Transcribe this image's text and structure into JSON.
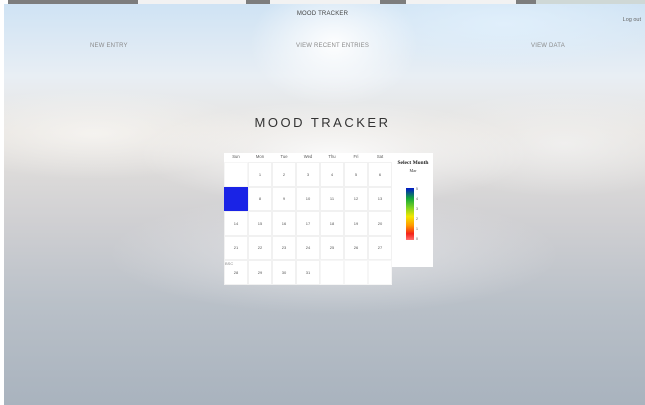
{
  "brand": "MOOD TRACKER",
  "logout": "Log out",
  "nav": {
    "new_entry": "NEW ENTRY",
    "recent": "VIEW RECENT ENTRIES",
    "data": "VIEW DATA"
  },
  "title": "MOOD TRACKER",
  "calendar": {
    "days_of_week": [
      "Sun",
      "Mon",
      "Tue",
      "Wed",
      "Thu",
      "Fri",
      "Sat"
    ],
    "leading_blanks": 1,
    "days_in_month": 31,
    "selected_day": 7,
    "selected_color": "#1a23e6",
    "footnote": "BSC"
  },
  "selector": {
    "title": "Select Month",
    "month": "Mar",
    "legend_labels": [
      "5",
      "4",
      "3",
      "2",
      "1",
      "0"
    ]
  }
}
